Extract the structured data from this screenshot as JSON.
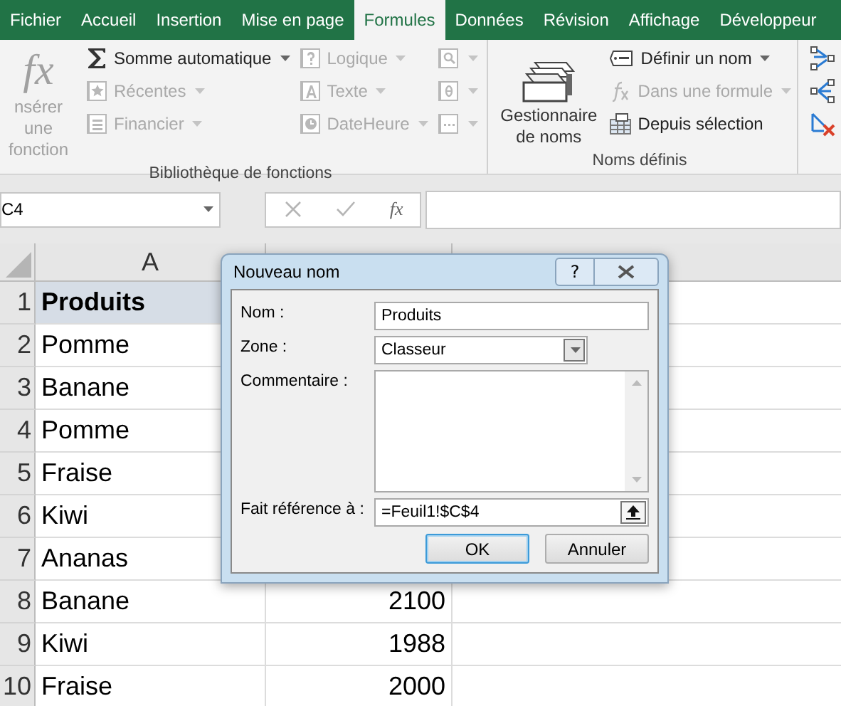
{
  "ribbon_tabs": [
    {
      "label": "Fichier",
      "selected": false
    },
    {
      "label": "Accueil",
      "selected": false
    },
    {
      "label": "Insertion",
      "selected": false
    },
    {
      "label": "Mise en page",
      "selected": false
    },
    {
      "label": "Formules",
      "selected": true
    },
    {
      "label": "Données",
      "selected": false
    },
    {
      "label": "Révision",
      "selected": false
    },
    {
      "label": "Affichage",
      "selected": false
    },
    {
      "label": "Développeur",
      "selected": false
    }
  ],
  "ribbon_groups": [
    {
      "title": "Bibliothèque de fonctions",
      "large_button": {
        "symbol": "fx",
        "label": "nsérer une fonction",
        "disabled": true
      },
      "columns": [
        [
          {
            "kind": "sum",
            "label": "Somme automatique",
            "disabled": false,
            "dropdown": true
          },
          {
            "kind": "star",
            "label": "Récentes",
            "disabled": true,
            "dropdown": true
          },
          {
            "kind": "lines",
            "label": "Financier",
            "disabled": true,
            "dropdown": true
          }
        ],
        [
          {
            "kind": "question",
            "label": "Logique",
            "disabled": true,
            "dropdown": true
          },
          {
            "kind": "letter",
            "label": "Texte",
            "disabled": true,
            "dropdown": true
          },
          {
            "kind": "clock",
            "label": "DateHeure",
            "disabled": true,
            "dropdown": true
          }
        ],
        [
          {
            "kind": "search",
            "disabled": true,
            "dropdown": true
          },
          {
            "kind": "theta",
            "disabled": true,
            "dropdown": true
          },
          {
            "kind": "dots",
            "disabled": true,
            "dropdown": true
          }
        ]
      ]
    },
    {
      "title": "Noms définis",
      "large_button": {
        "kind": "cards",
        "label": "Gestionnaire de noms",
        "disabled": false
      },
      "columns": [
        [
          {
            "kind": "tag",
            "label": "Définir un nom",
            "disabled": false,
            "dropdown": true
          },
          {
            "kind": "fx",
            "label": "Dans une formule",
            "disabled": true,
            "dropdown": true
          },
          {
            "kind": "table",
            "label": "Depuis sélection",
            "disabled": false,
            "dropdown": false
          }
        ]
      ]
    },
    {
      "columns": [
        [
          {
            "kind": "precedents",
            "dropdown": false
          },
          {
            "kind": "dependents",
            "dropdown": false
          },
          {
            "kind": "remove",
            "dropdown": false
          }
        ]
      ]
    }
  ],
  "name_box": {
    "value": "C4"
  },
  "formula_bar": {
    "buttons": [
      {
        "kind": "cancel"
      },
      {
        "kind": "enter"
      },
      {
        "kind": "fx",
        "label": "fx"
      }
    ]
  },
  "sheet": {
    "columns": [
      {
        "label": "A"
      }
    ],
    "rows": [
      {
        "number": "1",
        "a": "Produits",
        "bold": true,
        "selected": true
      },
      {
        "number": "2",
        "a": "Pomme",
        "bold": false,
        "selected": false
      },
      {
        "number": "3",
        "a": "Banane",
        "bold": false,
        "selected": false
      },
      {
        "number": "4",
        "a": "Pomme",
        "bold": false,
        "selected": false
      },
      {
        "number": "5",
        "a": "Fraise",
        "bold": false,
        "selected": false
      },
      {
        "number": "6",
        "a": "Kiwi",
        "bold": false,
        "selected": false
      },
      {
        "number": "7",
        "a": "Ananas",
        "bold": false,
        "selected": false
      },
      {
        "number": "8",
        "a": "Banane",
        "b": "2100",
        "bold": false,
        "selected": false
      },
      {
        "number": "9",
        "a": "Kiwi",
        "b": "1988",
        "bold": false,
        "selected": false
      },
      {
        "number": "10",
        "a": "Fraise",
        "b": "2000",
        "bold": false,
        "selected": false
      }
    ]
  },
  "dialog": {
    "title": "Nouveau nom",
    "help": "?",
    "fields": [
      {
        "kind": "text",
        "label": "Nom :",
        "value": "Produits"
      },
      {
        "kind": "select",
        "label": "Zone :",
        "value": "Classeur"
      },
      {
        "kind": "textarea",
        "label": "Commentaire :"
      },
      {
        "kind": "reference",
        "label": "Fait référence à :",
        "value": "=Feuil1!$C$4"
      }
    ],
    "buttons": [
      {
        "label": "OK",
        "default": true
      },
      {
        "label": "Annuler",
        "default": false
      }
    ]
  }
}
